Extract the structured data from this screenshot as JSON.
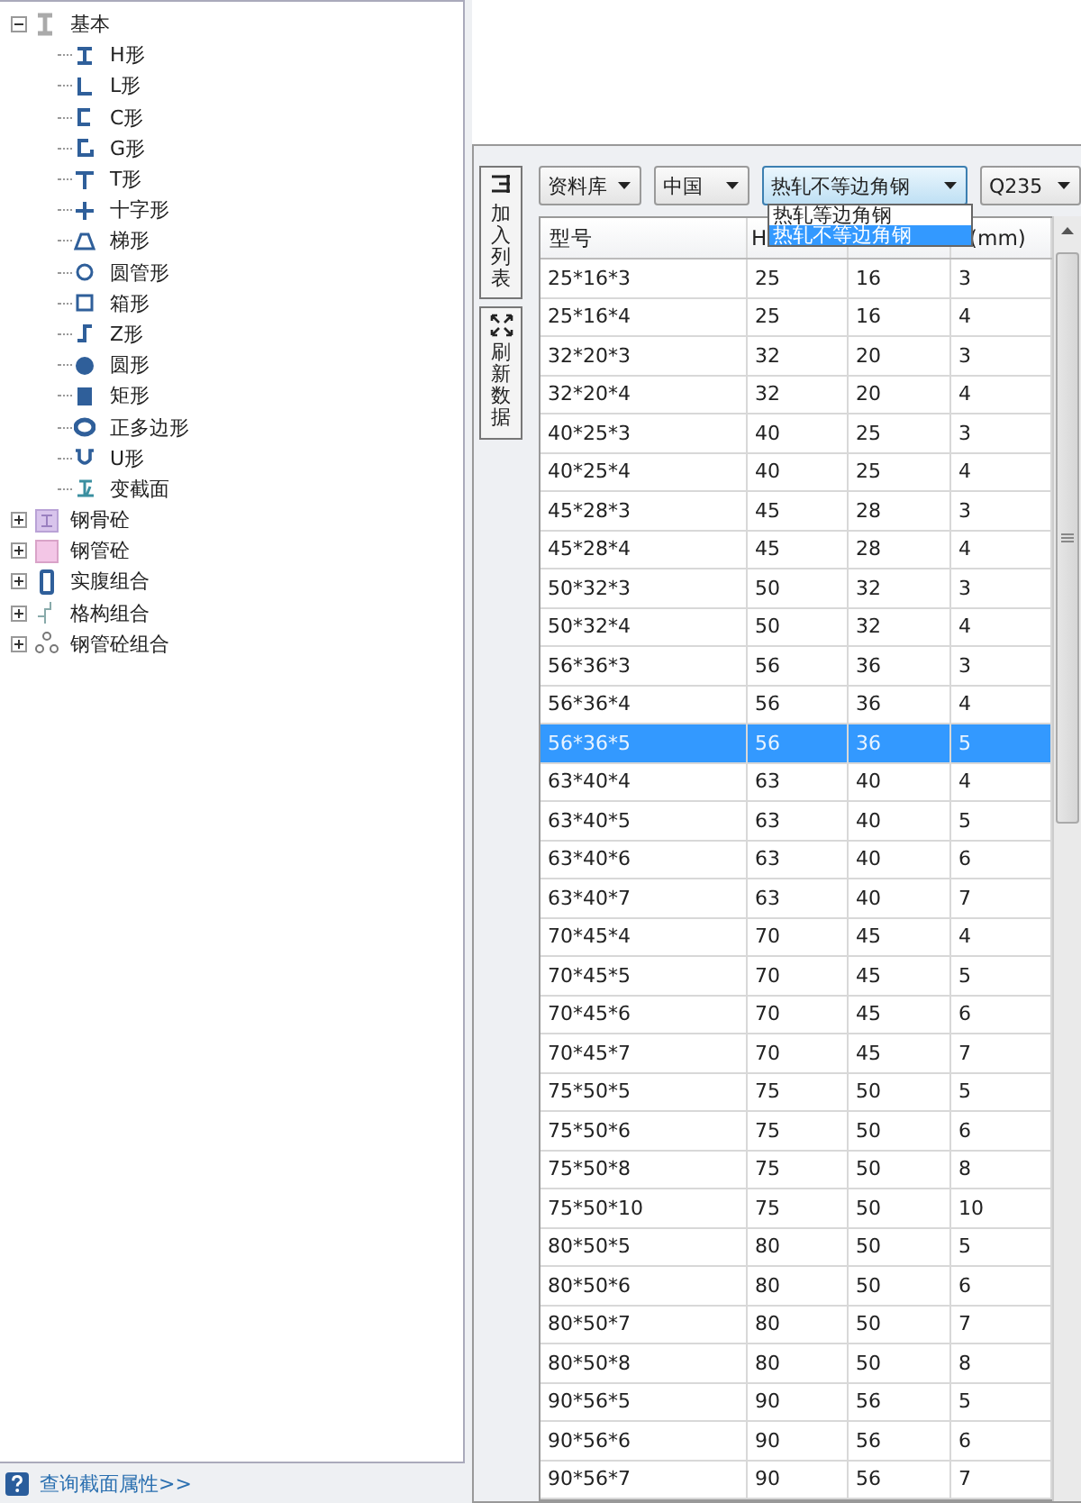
{
  "tree": {
    "label": "基本",
    "expanded": true,
    "children": [
      {
        "label": "H形"
      },
      {
        "label": "L形"
      },
      {
        "label": "C形"
      },
      {
        "label": "G形"
      },
      {
        "label": "T形"
      },
      {
        "label": "十字形"
      },
      {
        "label": "梯形"
      },
      {
        "label": "圆管形"
      },
      {
        "label": "箱形"
      },
      {
        "label": "Z形"
      },
      {
        "label": "圆形"
      },
      {
        "label": "矩形"
      },
      {
        "label": "正多边形"
      },
      {
        "label": "U形"
      },
      {
        "label": "变截面"
      }
    ],
    "siblings": [
      {
        "label": "钢骨砼",
        "expanded": false
      },
      {
        "label": "钢管砼",
        "expanded": false
      },
      {
        "label": "实腹组合",
        "expanded": false
      },
      {
        "label": "格构组合",
        "expanded": false
      },
      {
        "label": "钢管砼组合",
        "expanded": false
      }
    ]
  },
  "footer_link": "查询截面属性>>",
  "toolbar": [
    {
      "label": "加入列表"
    },
    {
      "label": "刷新数据"
    }
  ],
  "selects": [
    {
      "value": "资料库",
      "open": false
    },
    {
      "value": "中国",
      "open": false
    },
    {
      "value": "热轧不等边角钢",
      "open": true,
      "options": [
        {
          "label": "热轧等边角钢",
          "selected": false
        },
        {
          "label": "热轧不等边角钢",
          "selected": true
        }
      ]
    },
    {
      "value": "Q235",
      "open": false
    }
  ],
  "table": {
    "columns": [
      {
        "label": "型号"
      },
      {
        "label": "H"
      },
      {},
      {
        "label": "(mm)"
      }
    ],
    "rows": [
      {
        "cells": [
          "25*16*3",
          "25",
          "16",
          "3"
        ],
        "selected": false
      },
      {
        "cells": [
          "25*16*4",
          "25",
          "16",
          "4"
        ],
        "selected": false
      },
      {
        "cells": [
          "32*20*3",
          "32",
          "20",
          "3"
        ],
        "selected": false
      },
      {
        "cells": [
          "32*20*4",
          "32",
          "20",
          "4"
        ],
        "selected": false
      },
      {
        "cells": [
          "40*25*3",
          "40",
          "25",
          "3"
        ],
        "selected": false
      },
      {
        "cells": [
          "40*25*4",
          "40",
          "25",
          "4"
        ],
        "selected": false
      },
      {
        "cells": [
          "45*28*3",
          "45",
          "28",
          "3"
        ],
        "selected": false
      },
      {
        "cells": [
          "45*28*4",
          "45",
          "28",
          "4"
        ],
        "selected": false
      },
      {
        "cells": [
          "50*32*3",
          "50",
          "32",
          "3"
        ],
        "selected": false
      },
      {
        "cells": [
          "50*32*4",
          "50",
          "32",
          "4"
        ],
        "selected": false
      },
      {
        "cells": [
          "56*36*3",
          "56",
          "36",
          "3"
        ],
        "selected": false
      },
      {
        "cells": [
          "56*36*4",
          "56",
          "36",
          "4"
        ],
        "selected": false
      },
      {
        "cells": [
          "56*36*5",
          "56",
          "36",
          "5"
        ],
        "selected": true
      },
      {
        "cells": [
          "63*40*4",
          "63",
          "40",
          "4"
        ],
        "selected": false
      },
      {
        "cells": [
          "63*40*5",
          "63",
          "40",
          "5"
        ],
        "selected": false
      },
      {
        "cells": [
          "63*40*6",
          "63",
          "40",
          "6"
        ],
        "selected": false
      },
      {
        "cells": [
          "63*40*7",
          "63",
          "40",
          "7"
        ],
        "selected": false
      },
      {
        "cells": [
          "70*45*4",
          "70",
          "45",
          "4"
        ],
        "selected": false
      },
      {
        "cells": [
          "70*45*5",
          "70",
          "45",
          "5"
        ],
        "selected": false
      },
      {
        "cells": [
          "70*45*6",
          "70",
          "45",
          "6"
        ],
        "selected": false
      },
      {
        "cells": [
          "70*45*7",
          "70",
          "45",
          "7"
        ],
        "selected": false
      },
      {
        "cells": [
          "75*50*5",
          "75",
          "50",
          "5"
        ],
        "selected": false
      },
      {
        "cells": [
          "75*50*6",
          "75",
          "50",
          "6"
        ],
        "selected": false
      },
      {
        "cells": [
          "75*50*8",
          "75",
          "50",
          "8"
        ],
        "selected": false
      },
      {
        "cells": [
          "75*50*10",
          "75",
          "50",
          "10"
        ],
        "selected": false
      },
      {
        "cells": [
          "80*50*5",
          "80",
          "50",
          "5"
        ],
        "selected": false
      },
      {
        "cells": [
          "80*50*6",
          "80",
          "50",
          "6"
        ],
        "selected": false
      },
      {
        "cells": [
          "80*50*7",
          "80",
          "50",
          "7"
        ],
        "selected": false
      },
      {
        "cells": [
          "80*50*8",
          "80",
          "50",
          "8"
        ],
        "selected": false
      },
      {
        "cells": [
          "90*56*5",
          "90",
          "56",
          "5"
        ],
        "selected": false
      },
      {
        "cells": [
          "90*56*6",
          "90",
          "56",
          "6"
        ],
        "selected": false
      },
      {
        "cells": [
          "90*56*7",
          "90",
          "56",
          "7"
        ],
        "selected": false
      }
    ]
  }
}
